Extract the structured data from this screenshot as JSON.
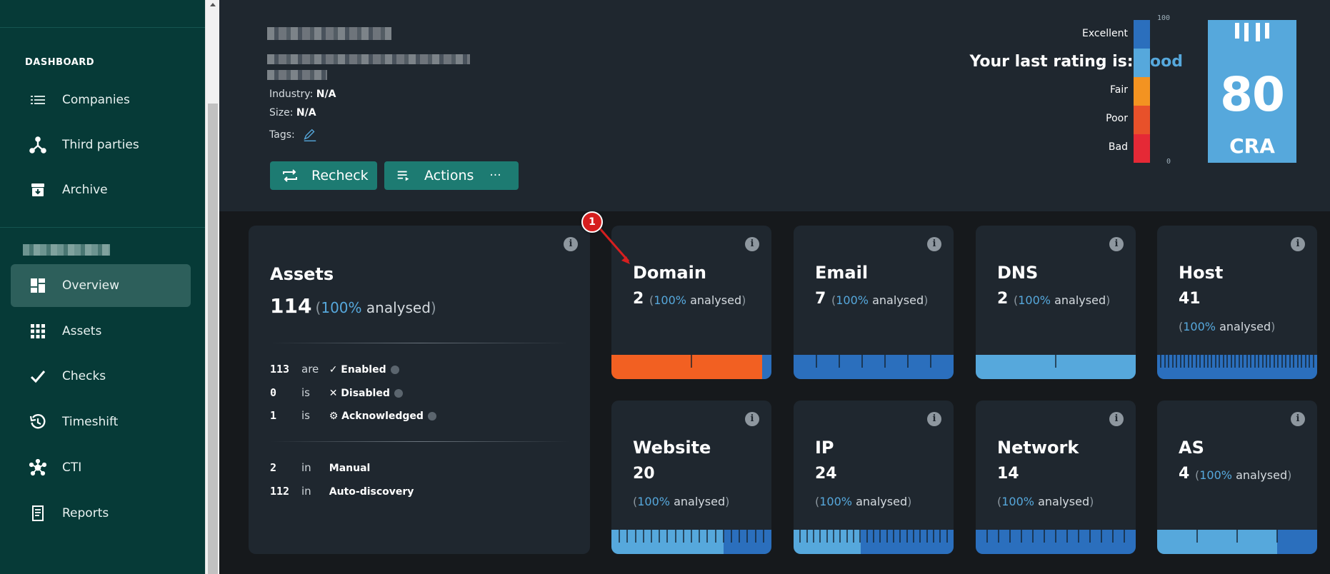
{
  "sidebar": {
    "section_dashboard": "DASHBOARD",
    "items_top": [
      {
        "label": "Companies",
        "icon": "list-icon"
      },
      {
        "label": "Third parties",
        "icon": "network-tree-icon"
      },
      {
        "label": "Archive",
        "icon": "archive-box-icon"
      }
    ],
    "items_company": [
      {
        "label": "Overview",
        "icon": "dashboard-grid-icon",
        "active": true
      },
      {
        "label": "Assets",
        "icon": "apps-grid-icon"
      },
      {
        "label": "Checks",
        "icon": "checkmark-icon"
      },
      {
        "label": "Timeshift",
        "icon": "history-clock-icon"
      },
      {
        "label": "CTI",
        "icon": "molecule-icon"
      },
      {
        "label": "Reports",
        "icon": "report-document-icon"
      }
    ]
  },
  "header": {
    "industry_label": "Industry:",
    "industry_value": "N/A",
    "size_label": "Size:",
    "size_value": "N/A",
    "tags_label": "Tags:",
    "recheck_label": "Recheck",
    "actions_label": "Actions",
    "actions_more": "···",
    "rating_prefix": "Your last rating is:",
    "rating_value": "good",
    "scale": {
      "max": "100",
      "min": "0",
      "labels": [
        "Excellent",
        "Fair",
        "Poor",
        "Bad"
      ],
      "colors": [
        "#2b6fbd",
        "#56a8dc",
        "#f39321",
        "#e8512a",
        "#e52936"
      ]
    },
    "score": "80",
    "score_unit": "CRA",
    "logo_icon": "brand-bars-icon"
  },
  "assets_card": {
    "title": "Assets",
    "count": "114",
    "pct": "100%",
    "analysed": "analysed",
    "rows": [
      {
        "num": "113",
        "verb": "are",
        "icon": "✓",
        "state": "Enabled"
      },
      {
        "num": "0",
        "verb": "is",
        "icon": "✕",
        "state": "Disabled"
      },
      {
        "num": "1",
        "verb": "is",
        "icon": "⚙",
        "state": "Acknowledged"
      }
    ],
    "sources": [
      {
        "num": "2",
        "verb": "in",
        "state": "Manual"
      },
      {
        "num": "112",
        "verb": "in",
        "state": "Auto-discovery"
      }
    ]
  },
  "cards": [
    {
      "title": "Domain",
      "count": "2",
      "pct": "100%",
      "analysed": "analysed",
      "colors": [
        "#f26022",
        "#2b6fbd"
      ],
      "shares": [
        0.94,
        0.06
      ],
      "ticks": 2
    },
    {
      "title": "Email",
      "count": "7",
      "pct": "100%",
      "analysed": "analysed",
      "colors": [
        "#2b6fbd"
      ],
      "shares": [
        1
      ],
      "ticks": 7
    },
    {
      "title": "DNS",
      "count": "2",
      "pct": "100%",
      "analysed": "analysed",
      "colors": [
        "#56a8dc"
      ],
      "shares": [
        1
      ],
      "ticks": 2
    },
    {
      "title": "Host",
      "count": "41",
      "pct": "100%",
      "analysed": "analysed",
      "colors": [
        "#2b6fbd"
      ],
      "shares": [
        1
      ],
      "ticks": 41
    },
    {
      "title": "Website",
      "count": "20",
      "pct": "100%",
      "analysed": "analysed",
      "colors": [
        "#56a8dc",
        "#2b6fbd"
      ],
      "shares": [
        0.7,
        0.3
      ],
      "ticks": 20
    },
    {
      "title": "IP",
      "count": "24",
      "pct": "100%",
      "analysed": "analysed",
      "colors": [
        "#56a8dc",
        "#2b6fbd"
      ],
      "shares": [
        0.42,
        0.58
      ],
      "ticks": 24
    },
    {
      "title": "Network",
      "count": "14",
      "pct": "100%",
      "analysed": "analysed",
      "colors": [
        "#2b6fbd"
      ],
      "shares": [
        1
      ],
      "ticks": 14
    },
    {
      "title": "AS",
      "count": "4",
      "pct": "100%",
      "analysed": "analysed",
      "colors": [
        "#56a8dc",
        "#2b6fbd"
      ],
      "shares": [
        0.75,
        0.25
      ],
      "ticks": 4
    }
  ],
  "callout": "1"
}
